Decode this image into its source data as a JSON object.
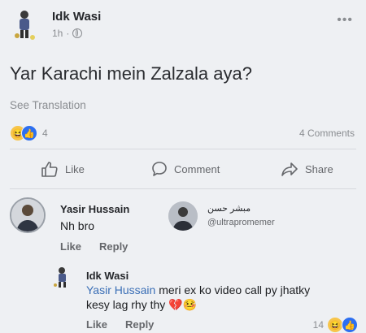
{
  "post": {
    "author": "Idk Wasi",
    "time": "1h",
    "more": "•••",
    "text": "Yar Karachi mein Zalzala aya?",
    "see_translation": "See Translation",
    "reaction_count": "4",
    "comments_count": "4 Comments"
  },
  "actions": {
    "like": "Like",
    "comment": "Comment",
    "share": "Share"
  },
  "comment": {
    "author": "Yasir Hussain",
    "text": "Nh bro",
    "like": "Like",
    "reply": "Reply"
  },
  "watermark": {
    "name": "مبشر حسن",
    "handle": "@ultrapromemer"
  },
  "reply": {
    "author": "Idk Wasi",
    "mention": "Yasir Hussain",
    "text": " meri ex ko video call py jhatky kesy lag rhy thy",
    "emoji": "💔🤒",
    "like": "Like",
    "reply": "Reply",
    "reaction_count": "14"
  },
  "colors": {
    "background": "#eef0f3",
    "mention": "#3b6fb6",
    "like_blue": "#2d6ff0",
    "haha_yellow": "#f7c54a",
    "muted": "#8a8d91"
  },
  "icons": [
    "globe-icon",
    "more-icon",
    "haha-reaction-icon",
    "like-reaction-icon",
    "like-icon",
    "comment-icon",
    "share-icon"
  ]
}
